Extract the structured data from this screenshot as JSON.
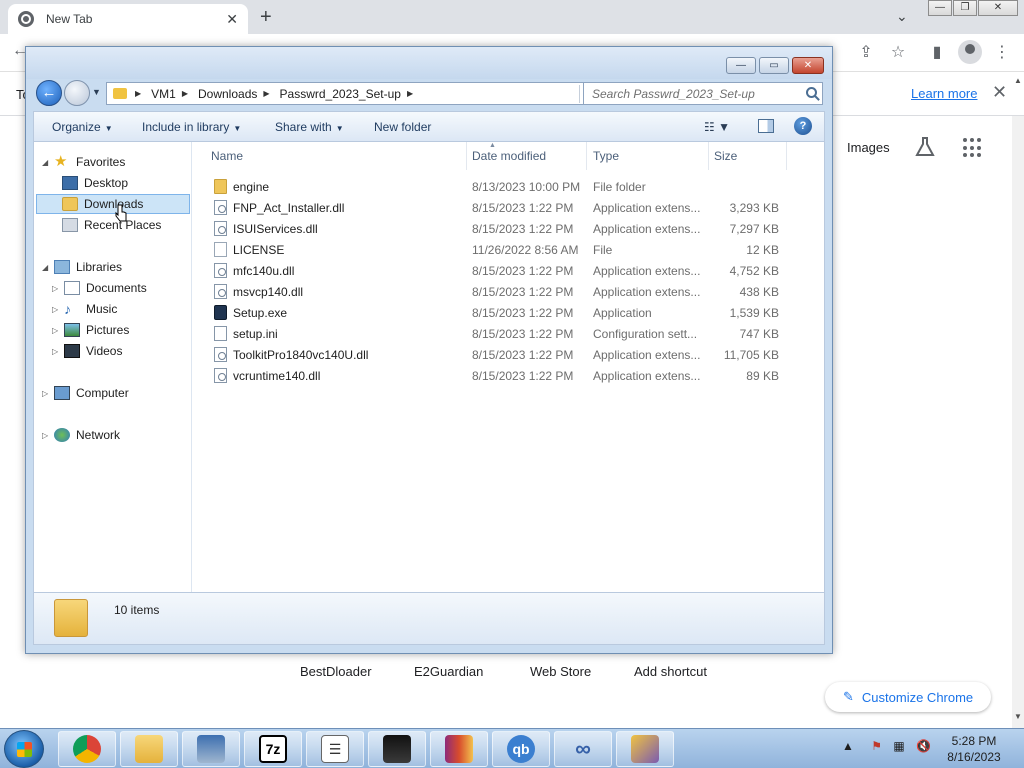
{
  "chrome": {
    "tab_title": "New Tab",
    "tab_close": "✕",
    "new_tab": "+",
    "tabstrip_chevron": "⌄",
    "window_controls": [
      "—",
      "❐",
      "✕"
    ],
    "infobar_text": "To",
    "learn_more": "Learn more",
    "infobar_close": "✕",
    "images": "Images",
    "shortcuts": [
      "BestDloader",
      "E2Guardian",
      "Web Store",
      "Add shortcut"
    ],
    "customize": "Customize Chrome"
  },
  "explorer": {
    "breadcrumb": [
      "VM1",
      "Downloads",
      "Passwrd_2023_Set-up"
    ],
    "search_placeholder": "Search Passwrd_2023_Set-up",
    "commands": {
      "organize": "Organize",
      "include_in_library": "Include in library",
      "share_with": "Share with",
      "new_folder": "New folder"
    },
    "nav": {
      "favorites": "Favorites",
      "desktop": "Desktop",
      "downloads": "Downloads",
      "recent_places": "Recent Places",
      "libraries": "Libraries",
      "documents": "Documents",
      "music": "Music",
      "pictures": "Pictures",
      "videos": "Videos",
      "computer": "Computer",
      "network": "Network"
    },
    "columns": {
      "name": "Name",
      "date": "Date modified",
      "type": "Type",
      "size": "Size"
    },
    "files": [
      {
        "name": "engine",
        "date": "8/13/2023 10:00 PM",
        "type": "File folder",
        "size": "",
        "icon": "folder-icon"
      },
      {
        "name": "FNP_Act_Installer.dll",
        "date": "8/15/2023 1:22 PM",
        "type": "Application extens...",
        "size": "3,293 KB",
        "icon": "dll-file-icon"
      },
      {
        "name": "ISUIServices.dll",
        "date": "8/15/2023 1:22 PM",
        "type": "Application extens...",
        "size": "7,297 KB",
        "icon": "dll-file-icon"
      },
      {
        "name": "LICENSE",
        "date": "11/26/2022 8:56 AM",
        "type": "File",
        "size": "12 KB",
        "icon": "blank-file-icon"
      },
      {
        "name": "mfc140u.dll",
        "date": "8/15/2023 1:22 PM",
        "type": "Application extens...",
        "size": "4,752 KB",
        "icon": "dll-file-icon"
      },
      {
        "name": "msvcp140.dll",
        "date": "8/15/2023 1:22 PM",
        "type": "Application extens...",
        "size": "438 KB",
        "icon": "dll-file-icon"
      },
      {
        "name": "Setup.exe",
        "date": "8/15/2023 1:22 PM",
        "type": "Application",
        "size": "1,539 KB",
        "icon": "setup-exe-icon"
      },
      {
        "name": "setup.ini",
        "date": "8/15/2023 1:22 PM",
        "type": "Configuration sett...",
        "size": "747 KB",
        "icon": "ini-file-icon"
      },
      {
        "name": "ToolkitPro1840vc140U.dll",
        "date": "8/15/2023 1:22 PM",
        "type": "Application extens...",
        "size": "11,705 KB",
        "icon": "dll-file-icon"
      },
      {
        "name": "vcruntime140.dll",
        "date": "8/15/2023 1:22 PM",
        "type": "Application extens...",
        "size": "89 KB",
        "icon": "dll-file-icon"
      }
    ],
    "item_count": "10 items"
  },
  "taskbar": {
    "apps": [
      "chrome-icon",
      "file-explorer-icon",
      "network-tool-icon",
      "7zip-icon",
      "list-app-icon",
      "cat-app-icon",
      "winrar-icon",
      "qbittorrent-icon",
      "infinity-app-icon",
      "installer-shield-icon"
    ],
    "sevenzip_label": "7z",
    "qb_label": "qb",
    "time": "5:28 PM",
    "date": "8/16/2023"
  },
  "colors": {
    "chrome_blue": "#1a73e8",
    "explorer_frame": "#c9dcf0",
    "selection": "#cce4f7",
    "taskbar": "#a9c7e8"
  }
}
